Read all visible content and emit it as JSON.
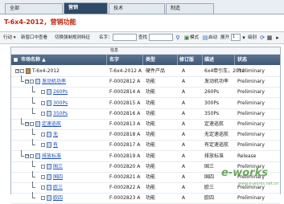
{
  "tabs": [
    {
      "label": "全部",
      "active": false
    },
    {
      "label": "营销",
      "active": true
    },
    {
      "label": "技术",
      "active": false
    },
    {
      "label": "制造",
      "active": false
    }
  ],
  "page_title": "T-6x4-2012，营销功能",
  "toolbar": {
    "action_label": "行动 ▾",
    "new_tab_label": "新窗口中查看",
    "switch_label": "切换强制规则特征",
    "name_label": "名字：",
    "name_value": "",
    "search_label": "查找",
    "search_value": "",
    "mode_label": "模式",
    "start_label": "启动",
    "expand_label": "展开",
    "expand_value": "1",
    "level_label": "级别"
  },
  "grid": {
    "group_header": "信息",
    "columns": [
      "市场名称 ▲",
      "名字",
      "类型",
      "修订版",
      "描述",
      "状态"
    ],
    "rows": [
      {
        "level": 0,
        "label": "T-6x4-2012",
        "name": "T-6x4-2012",
        "rev": "A",
        "type": "硬件产品",
        "revision": "A",
        "desc": "6x4牵引车，2012",
        "status": "Preliminary"
      },
      {
        "level": 1,
        "label": "发动机功率",
        "name": "F-0002812",
        "rev": "A",
        "type": "功能",
        "revision": "A",
        "desc": "发动机功率",
        "status": "Preliminary"
      },
      {
        "level": 2,
        "label": "260Ps",
        "name": "F-0002814",
        "rev": "A",
        "type": "功能",
        "revision": "A",
        "desc": "260Ps",
        "status": "Preliminary"
      },
      {
        "level": 2,
        "label": "300Ps",
        "name": "F-0002815",
        "rev": "A",
        "type": "功能",
        "revision": "A",
        "desc": "300Ps",
        "status": "Preliminary"
      },
      {
        "level": 2,
        "label": "350Ps",
        "name": "F-0002816",
        "rev": "A",
        "type": "功能",
        "revision": "A",
        "desc": "350Ps",
        "status": "Preliminary"
      },
      {
        "level": 1,
        "label": "定速巡航",
        "name": "F-0002813",
        "rev": "A",
        "type": "功能",
        "revision": "A",
        "desc": "定速巡航",
        "status": "Preliminary"
      },
      {
        "level": 2,
        "label": "无",
        "name": "F-0002818",
        "rev": "A",
        "type": "功能",
        "revision": "A",
        "desc": "无定速巡航",
        "status": "Preliminary"
      },
      {
        "level": 2,
        "label": "有",
        "name": "F-0002817",
        "rev": "A",
        "type": "功能",
        "revision": "A",
        "desc": "有定速巡航",
        "status": "Preliminary"
      },
      {
        "level": 1,
        "label": "排放标准",
        "name": "F-0002819",
        "rev": "A",
        "type": "功能",
        "revision": "A",
        "desc": "排放标准",
        "status": "Release"
      },
      {
        "level": 2,
        "label": "国三",
        "name": "F-0002820",
        "rev": "A",
        "type": "功能",
        "revision": "A",
        "desc": "国三",
        "status": "Preliminary"
      },
      {
        "level": 2,
        "label": "国四",
        "name": "F-0002821",
        "rev": "A",
        "type": "功能",
        "revision": "A",
        "desc": "国四",
        "status": "Preliminary"
      },
      {
        "level": 2,
        "label": "欧三",
        "name": "F-0002822",
        "rev": "A",
        "type": "功能",
        "revision": "A",
        "desc": "欧三",
        "status": "Preliminary"
      },
      {
        "level": 2,
        "label": "欧四",
        "name": "F-0002823",
        "rev": "A",
        "type": "功能",
        "revision": "A",
        "desc": "欧四",
        "status": "Preliminary"
      }
    ]
  },
  "watermark": {
    "brand": "e-works",
    "sub": "www.e-works.net.cn"
  },
  "colors": {
    "accent_red": "#c8240a",
    "header_blue": "#3f5876",
    "link_blue": "#1b4fbf",
    "tab_active": "#2e4a66"
  }
}
